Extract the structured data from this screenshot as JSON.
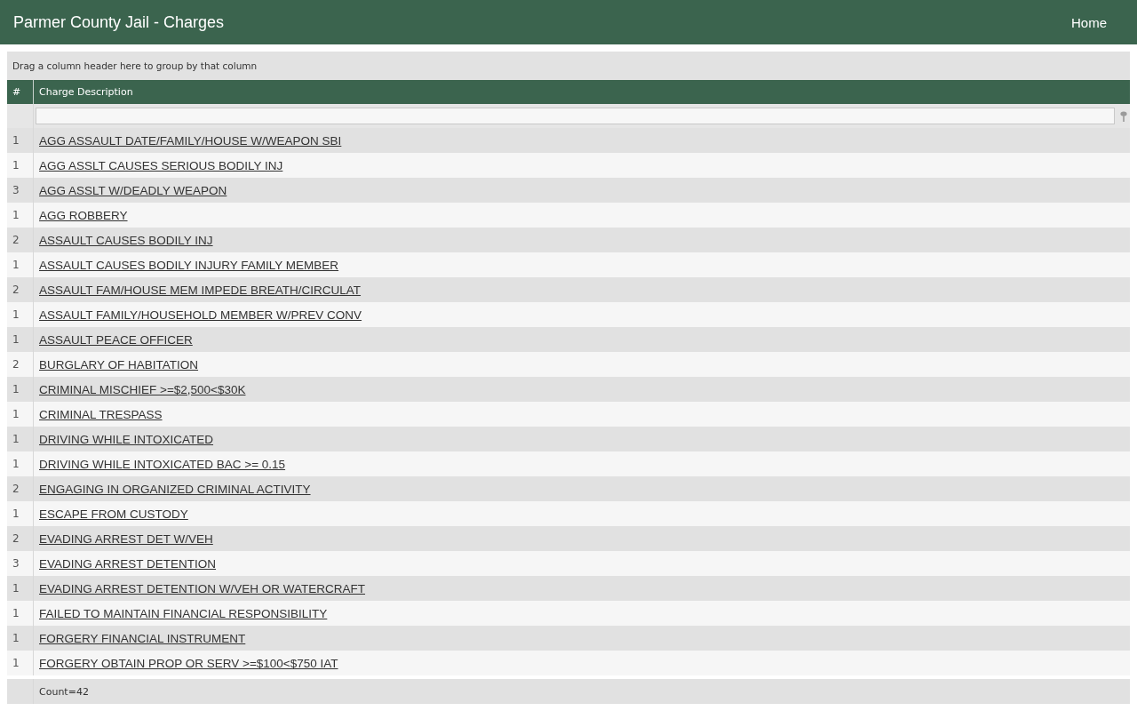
{
  "header": {
    "title": "Parmer County Jail - Charges",
    "nav": [
      {
        "label": "Home"
      }
    ]
  },
  "grid": {
    "group_panel": "Drag a column header here to group by that column",
    "columns": [
      "#",
      "Charge Description"
    ],
    "rows": [
      {
        "count": "1",
        "charge": "AGG ASSAULT DATE/FAMILY/HOUSE W/WEAPON SBI"
      },
      {
        "count": "1",
        "charge": "AGG ASSLT CAUSES SERIOUS BODILY INJ"
      },
      {
        "count": "3",
        "charge": "AGG ASSLT W/DEADLY WEAPON"
      },
      {
        "count": "1",
        "charge": "AGG ROBBERY"
      },
      {
        "count": "2",
        "charge": "ASSAULT CAUSES BODILY INJ"
      },
      {
        "count": "1",
        "charge": "ASSAULT CAUSES BODILY INJURY FAMILY MEMBER"
      },
      {
        "count": "2",
        "charge": "ASSAULT FAM/HOUSE MEM IMPEDE BREATH/CIRCULAT"
      },
      {
        "count": "1",
        "charge": "ASSAULT FAMILY/HOUSEHOLD MEMBER W/PREV CONV"
      },
      {
        "count": "1",
        "charge": "ASSAULT PEACE OFFICER"
      },
      {
        "count": "2",
        "charge": "BURGLARY OF HABITATION"
      },
      {
        "count": "1",
        "charge": "CRIMINAL MISCHIEF >=$2,500<$30K"
      },
      {
        "count": "1",
        "charge": "CRIMINAL TRESPASS"
      },
      {
        "count": "1",
        "charge": "DRIVING WHILE INTOXICATED"
      },
      {
        "count": "1",
        "charge": "DRIVING WHILE INTOXICATED BAC >= 0.15"
      },
      {
        "count": "2",
        "charge": "ENGAGING IN ORGANIZED CRIMINAL ACTIVITY"
      },
      {
        "count": "1",
        "charge": "ESCAPE FROM CUSTODY"
      },
      {
        "count": "2",
        "charge": "EVADING ARREST DET W/VEH"
      },
      {
        "count": "3",
        "charge": "EVADING ARREST DETENTION"
      },
      {
        "count": "1",
        "charge": "EVADING ARREST DETENTION W/VEH OR WATERCRAFT"
      },
      {
        "count": "1",
        "charge": "FAILED TO MAINTAIN FINANCIAL RESPONSIBILITY"
      },
      {
        "count": "1",
        "charge": "FORGERY FINANCIAL INSTRUMENT"
      },
      {
        "count": "1",
        "charge": "FORGERY OBTAIN PROP OR SERV >=$100<$750 IAT"
      }
    ],
    "footer": {
      "summary": "Count=42"
    }
  }
}
